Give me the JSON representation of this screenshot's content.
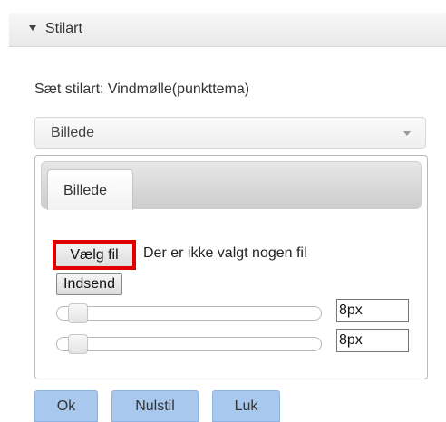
{
  "section": {
    "title": "Stilart",
    "icon": "caret-down-icon"
  },
  "set_style_label": "Sæt stilart: Vindmølle(punkttema)",
  "style_select": {
    "value": "Billede"
  },
  "tabs": [
    {
      "label": "Billede"
    }
  ],
  "file_input": {
    "button_label": "Vælg fil",
    "status": "Der er ikke valgt nogen fil"
  },
  "submit_label": "Indsend",
  "sliders": [
    {
      "value": "8px",
      "level": 0.04
    },
    {
      "value": "8px",
      "level": 0.04
    }
  ],
  "footer": {
    "ok": "Ok",
    "reset": "Nulstil",
    "close": "Luk"
  },
  "colors": {
    "highlight": "#e10000",
    "footer_button": "#a9c8ee"
  }
}
